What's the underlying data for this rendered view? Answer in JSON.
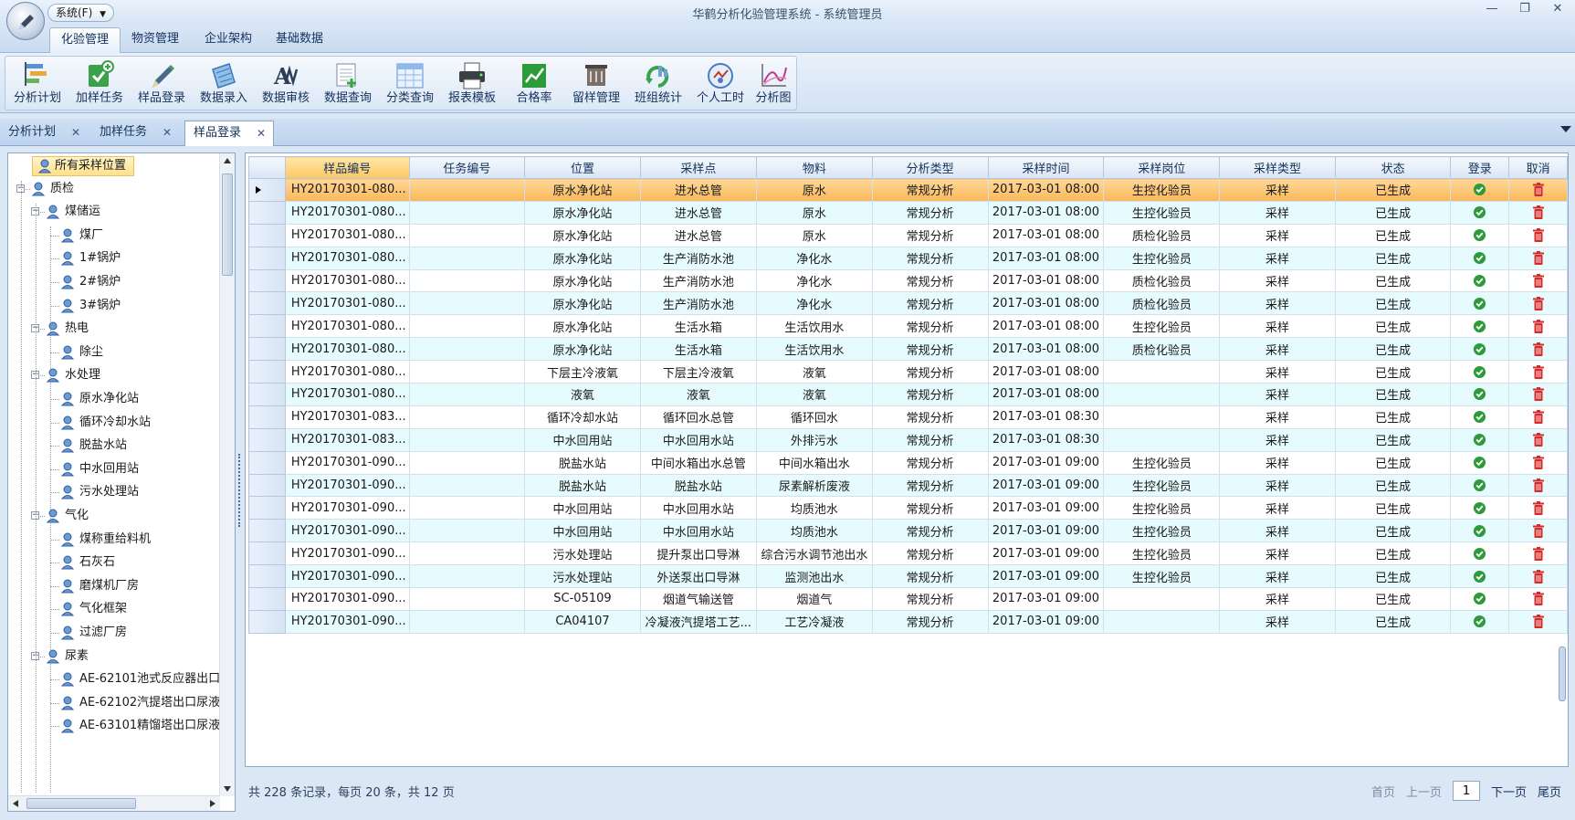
{
  "titlebar": {
    "system_menu": "系统(F)",
    "title": "华鹤分析化验管理系统 - 系统管理员"
  },
  "ribbon": {
    "tabs": [
      "化验管理",
      "物资管理",
      "企业架构",
      "基础数据"
    ],
    "active_tab": "化验管理",
    "buttons": [
      {
        "label": "分析计划",
        "icon": "analysis-plan-icon"
      },
      {
        "label": "加样任务",
        "icon": "add-task-icon"
      },
      {
        "label": "样品登录",
        "icon": "sample-login-icon"
      },
      {
        "label": "数据录入",
        "icon": "data-entry-icon"
      },
      {
        "label": "数据审核",
        "icon": "data-review-icon"
      },
      {
        "label": "数据查询",
        "icon": "data-query-icon"
      },
      {
        "label": "分类查询",
        "icon": "category-query-icon"
      },
      {
        "label": "报表模板",
        "icon": "report-template-icon"
      },
      {
        "label": "合格率",
        "icon": "pass-rate-icon"
      },
      {
        "label": "留样管理",
        "icon": "retained-sample-icon"
      },
      {
        "label": "班组统计",
        "icon": "team-stats-icon"
      },
      {
        "label": "个人工时",
        "icon": "personal-hours-icon"
      },
      {
        "label": "分析图",
        "icon": "analysis-chart-icon"
      }
    ]
  },
  "doc_tabs": [
    {
      "label": "分析计划",
      "active": false
    },
    {
      "label": "加样任务",
      "active": false
    },
    {
      "label": "样品登录",
      "active": true
    }
  ],
  "tree": {
    "root": "所有采样位置",
    "nodes": [
      {
        "label": "质检",
        "level": 1
      },
      {
        "label": "煤储运",
        "level": 2
      },
      {
        "label": "煤厂",
        "level": 3
      },
      {
        "label": "1#锅炉",
        "level": 3
      },
      {
        "label": "2#锅炉",
        "level": 3
      },
      {
        "label": "3#锅炉",
        "level": 3
      },
      {
        "label": "热电",
        "level": 2
      },
      {
        "label": "除尘",
        "level": 3
      },
      {
        "label": "水处理",
        "level": 2
      },
      {
        "label": "原水净化站",
        "level": 3
      },
      {
        "label": "循环冷却水站",
        "level": 3
      },
      {
        "label": "脱盐水站",
        "level": 3
      },
      {
        "label": "中水回用站",
        "level": 3
      },
      {
        "label": "污水处理站",
        "level": 3
      },
      {
        "label": "气化",
        "level": 2
      },
      {
        "label": "煤称重给料机",
        "level": 3
      },
      {
        "label": "石灰石",
        "level": 3
      },
      {
        "label": "磨煤机厂房",
        "level": 3
      },
      {
        "label": "气化框架",
        "level": 3
      },
      {
        "label": "过滤厂房",
        "level": 3
      },
      {
        "label": "尿素",
        "level": 2
      },
      {
        "label": "AE-62101池式反应器出口",
        "level": 3
      },
      {
        "label": "AE-62102汽提塔出口尿液",
        "level": 3
      },
      {
        "label": "AE-63101精馏塔出口尿液",
        "level": 3
      }
    ]
  },
  "grid": {
    "columns": [
      "样品编号",
      "任务编号",
      "位置",
      "采样点",
      "物料",
      "分析类型",
      "采样时间",
      "采样岗位",
      "采样类型",
      "状态",
      "登录",
      "取消"
    ],
    "rows": [
      [
        "HY20170301-080...",
        "",
        "原水净化站",
        "进水总管",
        "原水",
        "常规分析",
        "2017-03-01 08:00",
        "生控化验员",
        "采样",
        "已生成"
      ],
      [
        "HY20170301-080...",
        "",
        "原水净化站",
        "进水总管",
        "原水",
        "常规分析",
        "2017-03-01 08:00",
        "生控化验员",
        "采样",
        "已生成"
      ],
      [
        "HY20170301-080...",
        "",
        "原水净化站",
        "进水总管",
        "原水",
        "常规分析",
        "2017-03-01 08:00",
        "质检化验员",
        "采样",
        "已生成"
      ],
      [
        "HY20170301-080...",
        "",
        "原水净化站",
        "生产消防水池",
        "净化水",
        "常规分析",
        "2017-03-01 08:00",
        "生控化验员",
        "采样",
        "已生成"
      ],
      [
        "HY20170301-080...",
        "",
        "原水净化站",
        "生产消防水池",
        "净化水",
        "常规分析",
        "2017-03-01 08:00",
        "质检化验员",
        "采样",
        "已生成"
      ],
      [
        "HY20170301-080...",
        "",
        "原水净化站",
        "生产消防水池",
        "净化水",
        "常规分析",
        "2017-03-01 08:00",
        "质检化验员",
        "采样",
        "已生成"
      ],
      [
        "HY20170301-080...",
        "",
        "原水净化站",
        "生活水箱",
        "生活饮用水",
        "常规分析",
        "2017-03-01 08:00",
        "生控化验员",
        "采样",
        "已生成"
      ],
      [
        "HY20170301-080...",
        "",
        "原水净化站",
        "生活水箱",
        "生活饮用水",
        "常规分析",
        "2017-03-01 08:00",
        "质检化验员",
        "采样",
        "已生成"
      ],
      [
        "HY20170301-080...",
        "",
        "下层主冷液氧",
        "下层主冷液氧",
        "液氧",
        "常规分析",
        "2017-03-01 08:00",
        "",
        "采样",
        "已生成"
      ],
      [
        "HY20170301-080...",
        "",
        "液氧",
        "液氧",
        "液氧",
        "常规分析",
        "2017-03-01 08:00",
        "",
        "采样",
        "已生成"
      ],
      [
        "HY20170301-083...",
        "",
        "循环冷却水站",
        "循环回水总管",
        "循环回水",
        "常规分析",
        "2017-03-01 08:30",
        "",
        "采样",
        "已生成"
      ],
      [
        "HY20170301-083...",
        "",
        "中水回用站",
        "中水回用水站",
        "外排污水",
        "常规分析",
        "2017-03-01 08:30",
        "",
        "采样",
        "已生成"
      ],
      [
        "HY20170301-090...",
        "",
        "脱盐水站",
        "中间水箱出水总管",
        "中间水箱出水",
        "常规分析",
        "2017-03-01 09:00",
        "生控化验员",
        "采样",
        "已生成"
      ],
      [
        "HY20170301-090...",
        "",
        "脱盐水站",
        "脱盐水站",
        "尿素解析废液",
        "常规分析",
        "2017-03-01 09:00",
        "生控化验员",
        "采样",
        "已生成"
      ],
      [
        "HY20170301-090...",
        "",
        "中水回用站",
        "中水回用水站",
        "均质池水",
        "常规分析",
        "2017-03-01 09:00",
        "生控化验员",
        "采样",
        "已生成"
      ],
      [
        "HY20170301-090...",
        "",
        "中水回用站",
        "中水回用水站",
        "均质池水",
        "常规分析",
        "2017-03-01 09:00",
        "生控化验员",
        "采样",
        "已生成"
      ],
      [
        "HY20170301-090...",
        "",
        "污水处理站",
        "提升泵出口导淋",
        "综合污水调节池出水",
        "常规分析",
        "2017-03-01 09:00",
        "生控化验员",
        "采样",
        "已生成"
      ],
      [
        "HY20170301-090...",
        "",
        "污水处理站",
        "外送泵出口导淋",
        "监测池出水",
        "常规分析",
        "2017-03-01 09:00",
        "生控化验员",
        "采样",
        "已生成"
      ],
      [
        "HY20170301-090...",
        "",
        "SC-05109",
        "烟道气输送管",
        "烟道气",
        "常规分析",
        "2017-03-01 09:00",
        "",
        "采样",
        "已生成"
      ],
      [
        "HY20170301-090...",
        "",
        "CA04107",
        "冷凝液汽提塔工艺...",
        "工艺冷凝液",
        "常规分析",
        "2017-03-01 09:00",
        "",
        "采样",
        "已生成"
      ]
    ],
    "selected_row": 0
  },
  "pager": {
    "summary": "共 228 条记录，每页 20 条，共 12 页",
    "first": "首页",
    "prev": "上一页",
    "current_page": "1",
    "next": "下一页",
    "last": "尾页"
  },
  "colors": {
    "selected_row": "#f9b85a",
    "alt_row": "#e6fbfd",
    "ok": "#2e9b3a",
    "delete": "#d42a2a"
  }
}
